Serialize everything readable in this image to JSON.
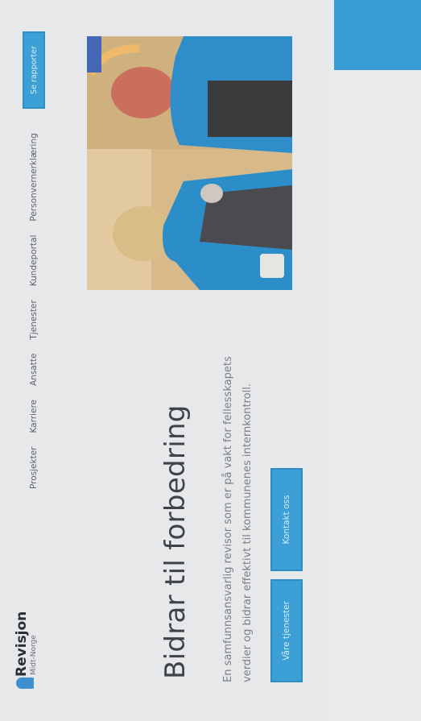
{
  "brand": {
    "name": "Revisjon",
    "subtitle": "Midt-Norge",
    "accent_color": "#3c9fd6",
    "logo_icon": "pm-logo-icon"
  },
  "nav": {
    "items": [
      {
        "label": "Prosjekter"
      },
      {
        "label": "Karriere"
      },
      {
        "label": "Ansatte"
      },
      {
        "label": "Tjenester"
      },
      {
        "label": "Kundeportal"
      },
      {
        "label": "Personvernerklæring"
      }
    ],
    "cta_label": "Se rapporter"
  },
  "hero": {
    "title": "Bidrar til forbedring",
    "description": "En samfunnsansvarlig revisor som er på vakt for fellesskapets verdier og bidrar effektivt til kommunenes internkontroll.",
    "primary_button": "Våre tjenester",
    "secondary_button": "Kontakt oss"
  }
}
